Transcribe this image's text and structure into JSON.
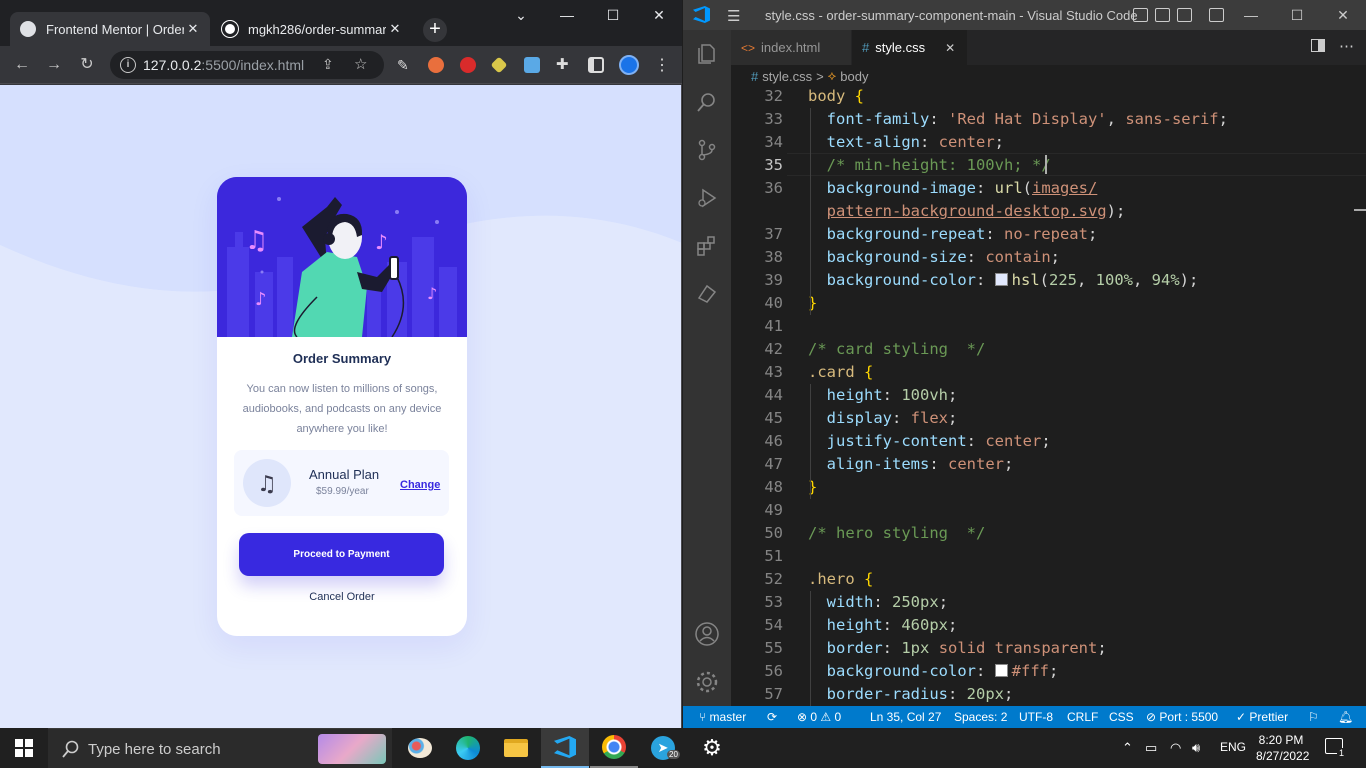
{
  "browser": {
    "tabs": [
      {
        "title": "Frontend Mentor | Order s",
        "close": "✕"
      },
      {
        "title": "mgkh286/order-summary",
        "close": "✕"
      }
    ],
    "new_tab": "+",
    "url_host": "127.0.0.2",
    "url_rest": ":5500/index.html",
    "window_controls": [
      "⌄",
      "—",
      "☐",
      "✕"
    ]
  },
  "card": {
    "title": "Order Summary",
    "description": "You can now listen to millions of songs, audiobooks, and podcasts on any device anywhere you like!",
    "plan_name": "Annual Plan",
    "plan_price": "$59.99/year",
    "change_link": "Change",
    "pay_button": "Proceed to Payment",
    "cancel_button": "Cancel Order"
  },
  "vscode": {
    "title": "style.css - order-summary-component-main - Visual Studio Code",
    "tabs": [
      {
        "label": "index.html",
        "icon": "<>"
      },
      {
        "label": "style.css",
        "icon": "#"
      }
    ],
    "tab_close": "✕",
    "breadcrumb": {
      "file": "style.css",
      "sep": ">",
      "symbol": "body"
    },
    "status": {
      "branch": "master",
      "errors": "0",
      "warnings": "0",
      "position": "Ln 35, Col 27",
      "spaces": "Spaces: 2",
      "encoding": "UTF-8",
      "eol": "CRLF",
      "language": "CSS",
      "port": "Port : 5500",
      "prettier": "Prettier"
    },
    "line_numbers": [
      "32",
      "33",
      "34",
      "35",
      "36",
      "",
      "37",
      "38",
      "39",
      "40",
      "41",
      "42",
      "43",
      "44",
      "45",
      "46",
      "47",
      "48",
      "49",
      "50",
      "51",
      "52",
      "53",
      "54",
      "55",
      "56",
      "57"
    ],
    "code": [
      {
        "t": "sel",
        "s": "body "
      },
      {
        "t": "br",
        "s": "{"
      },
      {
        "t": "nl"
      },
      {
        "t": "ind"
      },
      {
        "t": "prop",
        "s": "font-family"
      },
      {
        "t": "plain",
        "s": ": "
      },
      {
        "t": "val",
        "s": "'Red Hat Display'"
      },
      {
        "t": "plain",
        "s": ", "
      },
      {
        "t": "val",
        "s": "sans-serif"
      },
      {
        "t": "plain",
        "s": ";"
      },
      {
        "t": "nl"
      },
      {
        "t": "ind"
      },
      {
        "t": "prop",
        "s": "text-align"
      },
      {
        "t": "plain",
        "s": ": "
      },
      {
        "t": "val",
        "s": "center"
      },
      {
        "t": "plain",
        "s": ";"
      },
      {
        "t": "nl"
      },
      {
        "t": "ind"
      },
      {
        "t": "com",
        "s": "/* min-height: 100vh; */"
      },
      {
        "t": "nl"
      },
      {
        "t": "ind"
      },
      {
        "t": "prop",
        "s": "background-image"
      },
      {
        "t": "plain",
        "s": ": "
      },
      {
        "t": "fn",
        "s": "url"
      },
      {
        "t": "plain",
        "s": "("
      },
      {
        "t": "url",
        "s": "images/"
      },
      {
        "t": "nl"
      },
      {
        "t": "ind"
      },
      {
        "t": "url",
        "s": "pattern-background-desktop.svg"
      },
      {
        "t": "plain",
        "s": ");"
      },
      {
        "t": "nl"
      },
      {
        "t": "ind"
      },
      {
        "t": "prop",
        "s": "background-repeat"
      },
      {
        "t": "plain",
        "s": ": "
      },
      {
        "t": "val",
        "s": "no-repeat"
      },
      {
        "t": "plain",
        "s": ";"
      },
      {
        "t": "nl"
      },
      {
        "t": "ind"
      },
      {
        "t": "prop",
        "s": "background-size"
      },
      {
        "t": "plain",
        "s": ": "
      },
      {
        "t": "val",
        "s": "contain"
      },
      {
        "t": "plain",
        "s": ";"
      },
      {
        "t": "nl"
      },
      {
        "t": "ind"
      },
      {
        "t": "prop",
        "s": "background-color"
      },
      {
        "t": "plain",
        "s": ": "
      },
      {
        "t": "sw",
        "s": "#e1e8fd"
      },
      {
        "t": "fn",
        "s": "hsl"
      },
      {
        "t": "plain",
        "s": "("
      },
      {
        "t": "num",
        "s": "225"
      },
      {
        "t": "plain",
        "s": ", "
      },
      {
        "t": "num",
        "s": "100%"
      },
      {
        "t": "plain",
        "s": ", "
      },
      {
        "t": "num",
        "s": "94%"
      },
      {
        "t": "plain",
        "s": ");"
      },
      {
        "t": "nl"
      },
      {
        "t": "br",
        "s": "}"
      },
      {
        "t": "nl"
      },
      {
        "t": "nl"
      },
      {
        "t": "com",
        "s": "/* card styling  */"
      },
      {
        "t": "nl"
      },
      {
        "t": "sel",
        "s": ".card "
      },
      {
        "t": "br",
        "s": "{"
      },
      {
        "t": "nl"
      },
      {
        "t": "ind"
      },
      {
        "t": "prop",
        "s": "height"
      },
      {
        "t": "plain",
        "s": ": "
      },
      {
        "t": "num",
        "s": "100vh"
      },
      {
        "t": "plain",
        "s": ";"
      },
      {
        "t": "nl"
      },
      {
        "t": "ind"
      },
      {
        "t": "prop",
        "s": "display"
      },
      {
        "t": "plain",
        "s": ": "
      },
      {
        "t": "val",
        "s": "flex"
      },
      {
        "t": "plain",
        "s": ";"
      },
      {
        "t": "nl"
      },
      {
        "t": "ind"
      },
      {
        "t": "prop",
        "s": "justify-content"
      },
      {
        "t": "plain",
        "s": ": "
      },
      {
        "t": "val",
        "s": "center"
      },
      {
        "t": "plain",
        "s": ";"
      },
      {
        "t": "nl"
      },
      {
        "t": "ind"
      },
      {
        "t": "prop",
        "s": "align-items"
      },
      {
        "t": "plain",
        "s": ": "
      },
      {
        "t": "val",
        "s": "center"
      },
      {
        "t": "plain",
        "s": ";"
      },
      {
        "t": "nl"
      },
      {
        "t": "br",
        "s": "}"
      },
      {
        "t": "nl"
      },
      {
        "t": "nl"
      },
      {
        "t": "com",
        "s": "/* hero styling  */"
      },
      {
        "t": "nl"
      },
      {
        "t": "nl"
      },
      {
        "t": "sel",
        "s": ".hero "
      },
      {
        "t": "br",
        "s": "{"
      },
      {
        "t": "nl"
      },
      {
        "t": "ind"
      },
      {
        "t": "prop",
        "s": "width"
      },
      {
        "t": "plain",
        "s": ": "
      },
      {
        "t": "num",
        "s": "250px"
      },
      {
        "t": "plain",
        "s": ";"
      },
      {
        "t": "nl"
      },
      {
        "t": "ind"
      },
      {
        "t": "prop",
        "s": "height"
      },
      {
        "t": "plain",
        "s": ": "
      },
      {
        "t": "num",
        "s": "460px"
      },
      {
        "t": "plain",
        "s": ";"
      },
      {
        "t": "nl"
      },
      {
        "t": "ind"
      },
      {
        "t": "prop",
        "s": "border"
      },
      {
        "t": "plain",
        "s": ": "
      },
      {
        "t": "num",
        "s": "1px"
      },
      {
        "t": "plain",
        "s": " "
      },
      {
        "t": "val",
        "s": "solid transparent"
      },
      {
        "t": "plain",
        "s": ";"
      },
      {
        "t": "nl"
      },
      {
        "t": "ind"
      },
      {
        "t": "prop",
        "s": "background-color"
      },
      {
        "t": "plain",
        "s": ": "
      },
      {
        "t": "sw",
        "s": "#ffffff"
      },
      {
        "t": "val",
        "s": "#fff"
      },
      {
        "t": "plain",
        "s": ";"
      },
      {
        "t": "nl"
      },
      {
        "t": "ind"
      },
      {
        "t": "prop",
        "s": "border-radius"
      },
      {
        "t": "plain",
        "s": ": "
      },
      {
        "t": "num",
        "s": "20px"
      },
      {
        "t": "plain",
        "s": ";"
      }
    ]
  },
  "taskbar": {
    "search_placeholder": "Type here to search",
    "language": "ENG",
    "time": "8:20 PM",
    "date": "8/27/2022",
    "notification_count": "1",
    "telegram_badge": "20"
  },
  "colors": {
    "primary": "#3829e0",
    "page_bg": "#e1e8fd",
    "status_bar": "#007acc"
  }
}
